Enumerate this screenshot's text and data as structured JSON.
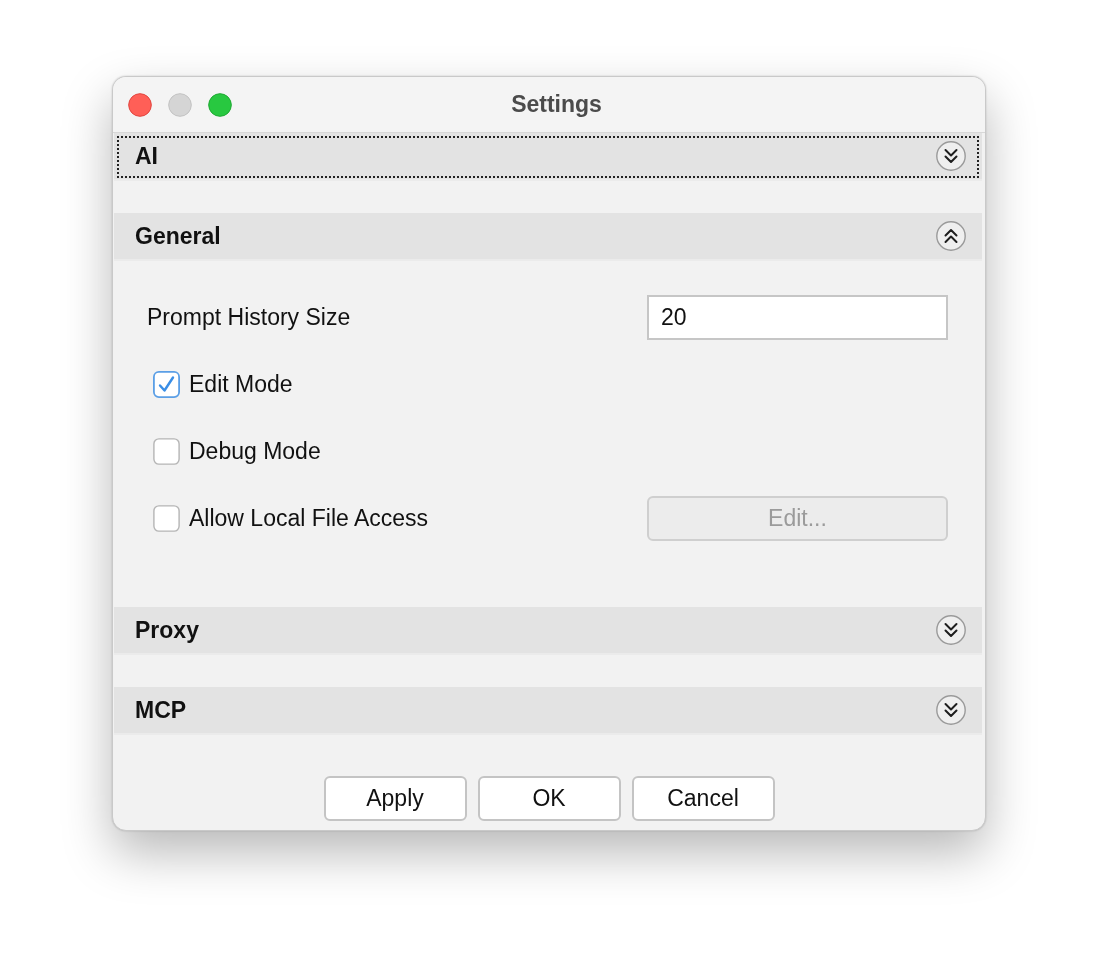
{
  "window": {
    "title": "Settings"
  },
  "sections": [
    {
      "title": "AI",
      "expanded": false,
      "focused": true
    },
    {
      "title": "General",
      "expanded": true,
      "focused": false,
      "settings": [
        {
          "kind": "field",
          "label": "Prompt History Size",
          "value": "20"
        },
        {
          "kind": "checkbox",
          "label": "Edit Mode",
          "checked": true
        },
        {
          "kind": "checkbox",
          "label": "Debug Mode",
          "checked": false
        },
        {
          "kind": "checkbox",
          "label": "Allow Local File Access",
          "checked": false,
          "button": {
            "label": "Edit...",
            "disabled": true
          }
        }
      ]
    },
    {
      "title": "Proxy",
      "expanded": false,
      "focused": false
    },
    {
      "title": "MCP",
      "expanded": false,
      "focused": false
    }
  ],
  "buttons": [
    "Apply",
    "OK",
    "Cancel"
  ]
}
